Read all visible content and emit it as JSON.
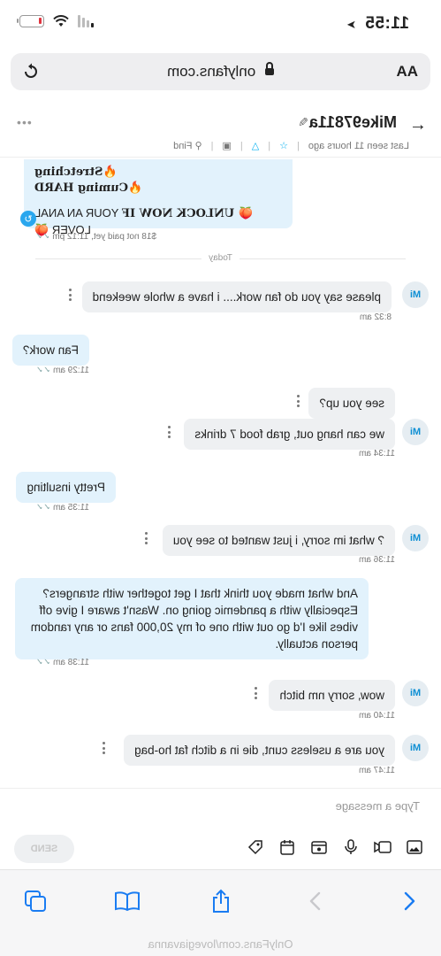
{
  "status": {
    "time": "11:55",
    "arrow": "➤",
    "battery_level": 0.15,
    "battery_color": "#e0343f"
  },
  "browser": {
    "aa": "AA",
    "url": "onlyfans.com"
  },
  "chat": {
    "name": "Mike97811a",
    "last_seen": "Last seen 11 hours ago",
    "find": "Find",
    "back_icon": "arrow-left-icon"
  },
  "messages": {
    "paid": {
      "line1": "🔥Stretching",
      "line2": "🔥Cuming HARD",
      "line3_bold": "🍑 UNLOCK NOW IF",
      "line3_rest": " YOUR AN ANAL LOVER 🍑",
      "status": "$18 not paid yet, 11:12 pm"
    },
    "today": "Today",
    "items": [
      {
        "side": "them",
        "text": "please say you do fan work.... i have a whole weekend",
        "time": "8:32 am"
      },
      {
        "side": "me",
        "text": "Fan work?",
        "time": "11:29 am"
      },
      {
        "side": "them",
        "text": "see you up?",
        "time": ""
      },
      {
        "side": "them",
        "text": "we can hang out, grab food 7 drinks",
        "time": "11:34 am"
      },
      {
        "side": "me",
        "text": "Pretty insulting",
        "time": "11:35 am"
      },
      {
        "side": "them",
        "text": "? what im sorry, i just wanted to see you",
        "time": "11:36 am"
      },
      {
        "side": "me",
        "text": "And what made you think that I get together with strangers? Especially with a pandemic going on. Wasn't aware I give off vibes like I'd go out with one of my 20,000 fans or any random person actually.",
        "time": "11:38 am"
      },
      {
        "side": "them",
        "text": "wow, sorry nm bitch",
        "time": "11:40 am"
      },
      {
        "side": "them",
        "text": "you are a useless cunt, die in a ditch fat ho-bag",
        "time": "11:47 am"
      }
    ],
    "avatar": "Mi"
  },
  "composer": {
    "placeholder": "Type a message",
    "send": "SEND"
  },
  "safari": {
    "home_url": "OnlyFans.com/lovegiavanna"
  },
  "colors": {
    "accent": "#00aff0",
    "my_bubble": "#e2f2fc",
    "their_bubble": "#eef0f2"
  }
}
